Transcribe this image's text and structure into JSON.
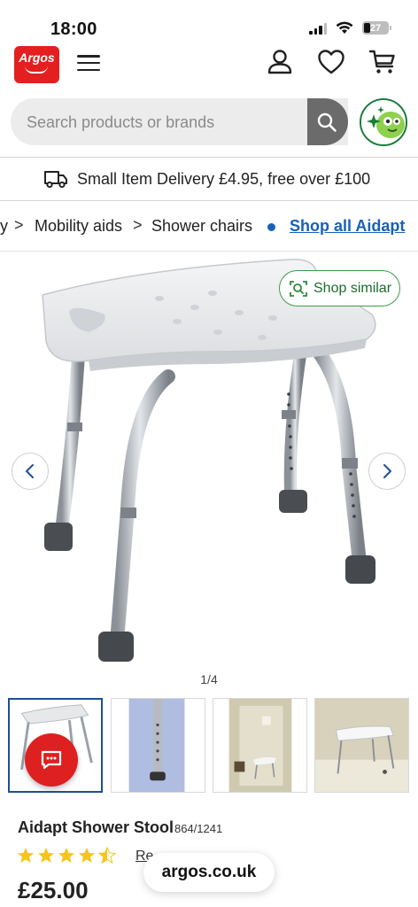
{
  "status_bar": {
    "time": "18:00",
    "battery": "27"
  },
  "header": {
    "logo_text": "Argos"
  },
  "search": {
    "placeholder": "Search products or brands"
  },
  "delivery": {
    "text": "Small Item Delivery £4.95, free over £100"
  },
  "breadcrumb": {
    "items": [
      "y",
      "Mobility aids",
      "Shower chairs"
    ],
    "link": "Shop all Aidapt"
  },
  "gallery": {
    "shop_similar": "Shop similar",
    "counter": "1/4"
  },
  "product": {
    "title": "Aidapt Shower Stool",
    "code": "864/1241",
    "rating": 4.5,
    "reviews_text": "Re",
    "price": "£25.00"
  },
  "browser": {
    "url": "argos.co.uk"
  },
  "colors": {
    "brand_red": "#e41f1f",
    "link_blue": "#1761b9",
    "accent_green": "#3e9a4a",
    "star_yellow": "#f5c518"
  }
}
